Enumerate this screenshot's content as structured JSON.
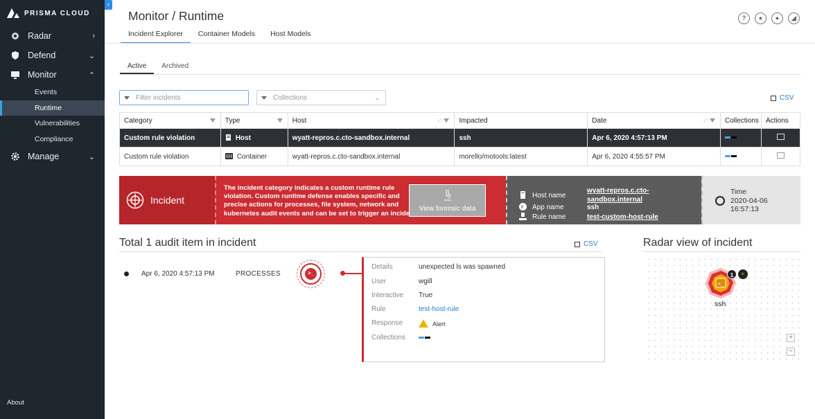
{
  "brand": {
    "name": "PRISMA CLOUD"
  },
  "sidebar": {
    "items": [
      {
        "label": "Radar",
        "chevron": ">"
      },
      {
        "label": "Defend",
        "chevron": "v"
      },
      {
        "label": "Monitor",
        "chevron": "^"
      },
      {
        "label": "Manage",
        "chevron": "v"
      }
    ],
    "monitor_sub": [
      "Events",
      "Runtime",
      "Vulnerabilities",
      "Compliance"
    ],
    "about": "About"
  },
  "header": {
    "title": "Monitor / Runtime",
    "tabs": [
      "Incident Explorer",
      "Container Models",
      "Host Models"
    ]
  },
  "subtabs": [
    "Active",
    "Archived"
  ],
  "filters": {
    "incidents_placeholder": "Filter incidents",
    "collections_placeholder": "Collections",
    "csv": "CSV"
  },
  "table": {
    "columns": [
      "Category",
      "Type",
      "Host",
      "Impacted",
      "Date",
      "Collections",
      "Actions"
    ],
    "rows": [
      {
        "category": "Custom rule violation",
        "type": "Host",
        "host": "wyatt-repros.c.cto-sandbox.internal",
        "impacted": "ssh",
        "date": "Apr 6, 2020 4:57:13 PM"
      },
      {
        "category": "Custom rule violation",
        "type": "Container",
        "host": "wyatt-repros.c.cto-sandbox.internal",
        "impacted": "morello/motools:latest",
        "date": "Apr 6, 2020 4:55:57 PM"
      }
    ]
  },
  "incident": {
    "title": "Incident",
    "description": "The incident category indicates a custom runtime rule violation. Custom runtime defense enables specific and precise actions for processes, file system, network and kubernetes audit events and can be set to trigger an incident",
    "forensic_button": "View forensic data",
    "host_label": "Host name",
    "host_value": "wyatt-repros.c.cto-sandbox.internal",
    "app_label": "App name",
    "app_value": "ssh",
    "rule_label": "Rule name",
    "rule_value": "test-custom-host-rule",
    "time_label": "Time",
    "time_date": "2020-04-06",
    "time_clock": "16:57:13"
  },
  "audit": {
    "title": "Total 1 audit item in incident",
    "csv": "CSV",
    "date": "Apr 6, 2020 4:57:13 PM",
    "type": "PROCESSES",
    "details": [
      {
        "k": "Details",
        "v": "unexpected ls was spawned"
      },
      {
        "k": "User",
        "v": "wgill"
      },
      {
        "k": "Interactive",
        "v": "True"
      },
      {
        "k": "Rule",
        "v": "test-host-rule"
      },
      {
        "k": "Response",
        "v": "Alert"
      },
      {
        "k": "Collections",
        "v": ""
      }
    ]
  },
  "radar": {
    "title": "Radar view of incident",
    "node_label": "ssh",
    "badge_count": "1",
    "zoom_in": "+",
    "zoom_out": "−"
  },
  "colors": {
    "accent": "#cb2d33",
    "link": "#2e7bc7",
    "sidebar": "#1e262e"
  }
}
